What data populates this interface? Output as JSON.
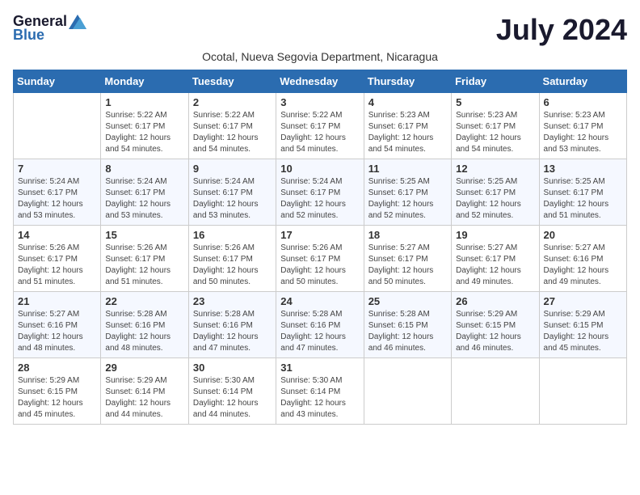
{
  "logo": {
    "general": "General",
    "blue": "Blue"
  },
  "header": {
    "month_year": "July 2024",
    "location": "Ocotal, Nueva Segovia Department, Nicaragua"
  },
  "weekdays": [
    "Sunday",
    "Monday",
    "Tuesday",
    "Wednesday",
    "Thursday",
    "Friday",
    "Saturday"
  ],
  "weeks": [
    [
      {
        "day": "",
        "sunrise": "",
        "sunset": "",
        "daylight": ""
      },
      {
        "day": "1",
        "sunrise": "Sunrise: 5:22 AM",
        "sunset": "Sunset: 6:17 PM",
        "daylight": "Daylight: 12 hours and 54 minutes."
      },
      {
        "day": "2",
        "sunrise": "Sunrise: 5:22 AM",
        "sunset": "Sunset: 6:17 PM",
        "daylight": "Daylight: 12 hours and 54 minutes."
      },
      {
        "day": "3",
        "sunrise": "Sunrise: 5:22 AM",
        "sunset": "Sunset: 6:17 PM",
        "daylight": "Daylight: 12 hours and 54 minutes."
      },
      {
        "day": "4",
        "sunrise": "Sunrise: 5:23 AM",
        "sunset": "Sunset: 6:17 PM",
        "daylight": "Daylight: 12 hours and 54 minutes."
      },
      {
        "day": "5",
        "sunrise": "Sunrise: 5:23 AM",
        "sunset": "Sunset: 6:17 PM",
        "daylight": "Daylight: 12 hours and 54 minutes."
      },
      {
        "day": "6",
        "sunrise": "Sunrise: 5:23 AM",
        "sunset": "Sunset: 6:17 PM",
        "daylight": "Daylight: 12 hours and 53 minutes."
      }
    ],
    [
      {
        "day": "7",
        "sunrise": "Sunrise: 5:24 AM",
        "sunset": "Sunset: 6:17 PM",
        "daylight": "Daylight: 12 hours and 53 minutes."
      },
      {
        "day": "8",
        "sunrise": "Sunrise: 5:24 AM",
        "sunset": "Sunset: 6:17 PM",
        "daylight": "Daylight: 12 hours and 53 minutes."
      },
      {
        "day": "9",
        "sunrise": "Sunrise: 5:24 AM",
        "sunset": "Sunset: 6:17 PM",
        "daylight": "Daylight: 12 hours and 53 minutes."
      },
      {
        "day": "10",
        "sunrise": "Sunrise: 5:24 AM",
        "sunset": "Sunset: 6:17 PM",
        "daylight": "Daylight: 12 hours and 52 minutes."
      },
      {
        "day": "11",
        "sunrise": "Sunrise: 5:25 AM",
        "sunset": "Sunset: 6:17 PM",
        "daylight": "Daylight: 12 hours and 52 minutes."
      },
      {
        "day": "12",
        "sunrise": "Sunrise: 5:25 AM",
        "sunset": "Sunset: 6:17 PM",
        "daylight": "Daylight: 12 hours and 52 minutes."
      },
      {
        "day": "13",
        "sunrise": "Sunrise: 5:25 AM",
        "sunset": "Sunset: 6:17 PM",
        "daylight": "Daylight: 12 hours and 51 minutes."
      }
    ],
    [
      {
        "day": "14",
        "sunrise": "Sunrise: 5:26 AM",
        "sunset": "Sunset: 6:17 PM",
        "daylight": "Daylight: 12 hours and 51 minutes."
      },
      {
        "day": "15",
        "sunrise": "Sunrise: 5:26 AM",
        "sunset": "Sunset: 6:17 PM",
        "daylight": "Daylight: 12 hours and 51 minutes."
      },
      {
        "day": "16",
        "sunrise": "Sunrise: 5:26 AM",
        "sunset": "Sunset: 6:17 PM",
        "daylight": "Daylight: 12 hours and 50 minutes."
      },
      {
        "day": "17",
        "sunrise": "Sunrise: 5:26 AM",
        "sunset": "Sunset: 6:17 PM",
        "daylight": "Daylight: 12 hours and 50 minutes."
      },
      {
        "day": "18",
        "sunrise": "Sunrise: 5:27 AM",
        "sunset": "Sunset: 6:17 PM",
        "daylight": "Daylight: 12 hours and 50 minutes."
      },
      {
        "day": "19",
        "sunrise": "Sunrise: 5:27 AM",
        "sunset": "Sunset: 6:17 PM",
        "daylight": "Daylight: 12 hours and 49 minutes."
      },
      {
        "day": "20",
        "sunrise": "Sunrise: 5:27 AM",
        "sunset": "Sunset: 6:16 PM",
        "daylight": "Daylight: 12 hours and 49 minutes."
      }
    ],
    [
      {
        "day": "21",
        "sunrise": "Sunrise: 5:27 AM",
        "sunset": "Sunset: 6:16 PM",
        "daylight": "Daylight: 12 hours and 48 minutes."
      },
      {
        "day": "22",
        "sunrise": "Sunrise: 5:28 AM",
        "sunset": "Sunset: 6:16 PM",
        "daylight": "Daylight: 12 hours and 48 minutes."
      },
      {
        "day": "23",
        "sunrise": "Sunrise: 5:28 AM",
        "sunset": "Sunset: 6:16 PM",
        "daylight": "Daylight: 12 hours and 47 minutes."
      },
      {
        "day": "24",
        "sunrise": "Sunrise: 5:28 AM",
        "sunset": "Sunset: 6:16 PM",
        "daylight": "Daylight: 12 hours and 47 minutes."
      },
      {
        "day": "25",
        "sunrise": "Sunrise: 5:28 AM",
        "sunset": "Sunset: 6:15 PM",
        "daylight": "Daylight: 12 hours and 46 minutes."
      },
      {
        "day": "26",
        "sunrise": "Sunrise: 5:29 AM",
        "sunset": "Sunset: 6:15 PM",
        "daylight": "Daylight: 12 hours and 46 minutes."
      },
      {
        "day": "27",
        "sunrise": "Sunrise: 5:29 AM",
        "sunset": "Sunset: 6:15 PM",
        "daylight": "Daylight: 12 hours and 45 minutes."
      }
    ],
    [
      {
        "day": "28",
        "sunrise": "Sunrise: 5:29 AM",
        "sunset": "Sunset: 6:15 PM",
        "daylight": "Daylight: 12 hours and 45 minutes."
      },
      {
        "day": "29",
        "sunrise": "Sunrise: 5:29 AM",
        "sunset": "Sunset: 6:14 PM",
        "daylight": "Daylight: 12 hours and 44 minutes."
      },
      {
        "day": "30",
        "sunrise": "Sunrise: 5:30 AM",
        "sunset": "Sunset: 6:14 PM",
        "daylight": "Daylight: 12 hours and 44 minutes."
      },
      {
        "day": "31",
        "sunrise": "Sunrise: 5:30 AM",
        "sunset": "Sunset: 6:14 PM",
        "daylight": "Daylight: 12 hours and 43 minutes."
      },
      {
        "day": "",
        "sunrise": "",
        "sunset": "",
        "daylight": ""
      },
      {
        "day": "",
        "sunrise": "",
        "sunset": "",
        "daylight": ""
      },
      {
        "day": "",
        "sunrise": "",
        "sunset": "",
        "daylight": ""
      }
    ]
  ]
}
